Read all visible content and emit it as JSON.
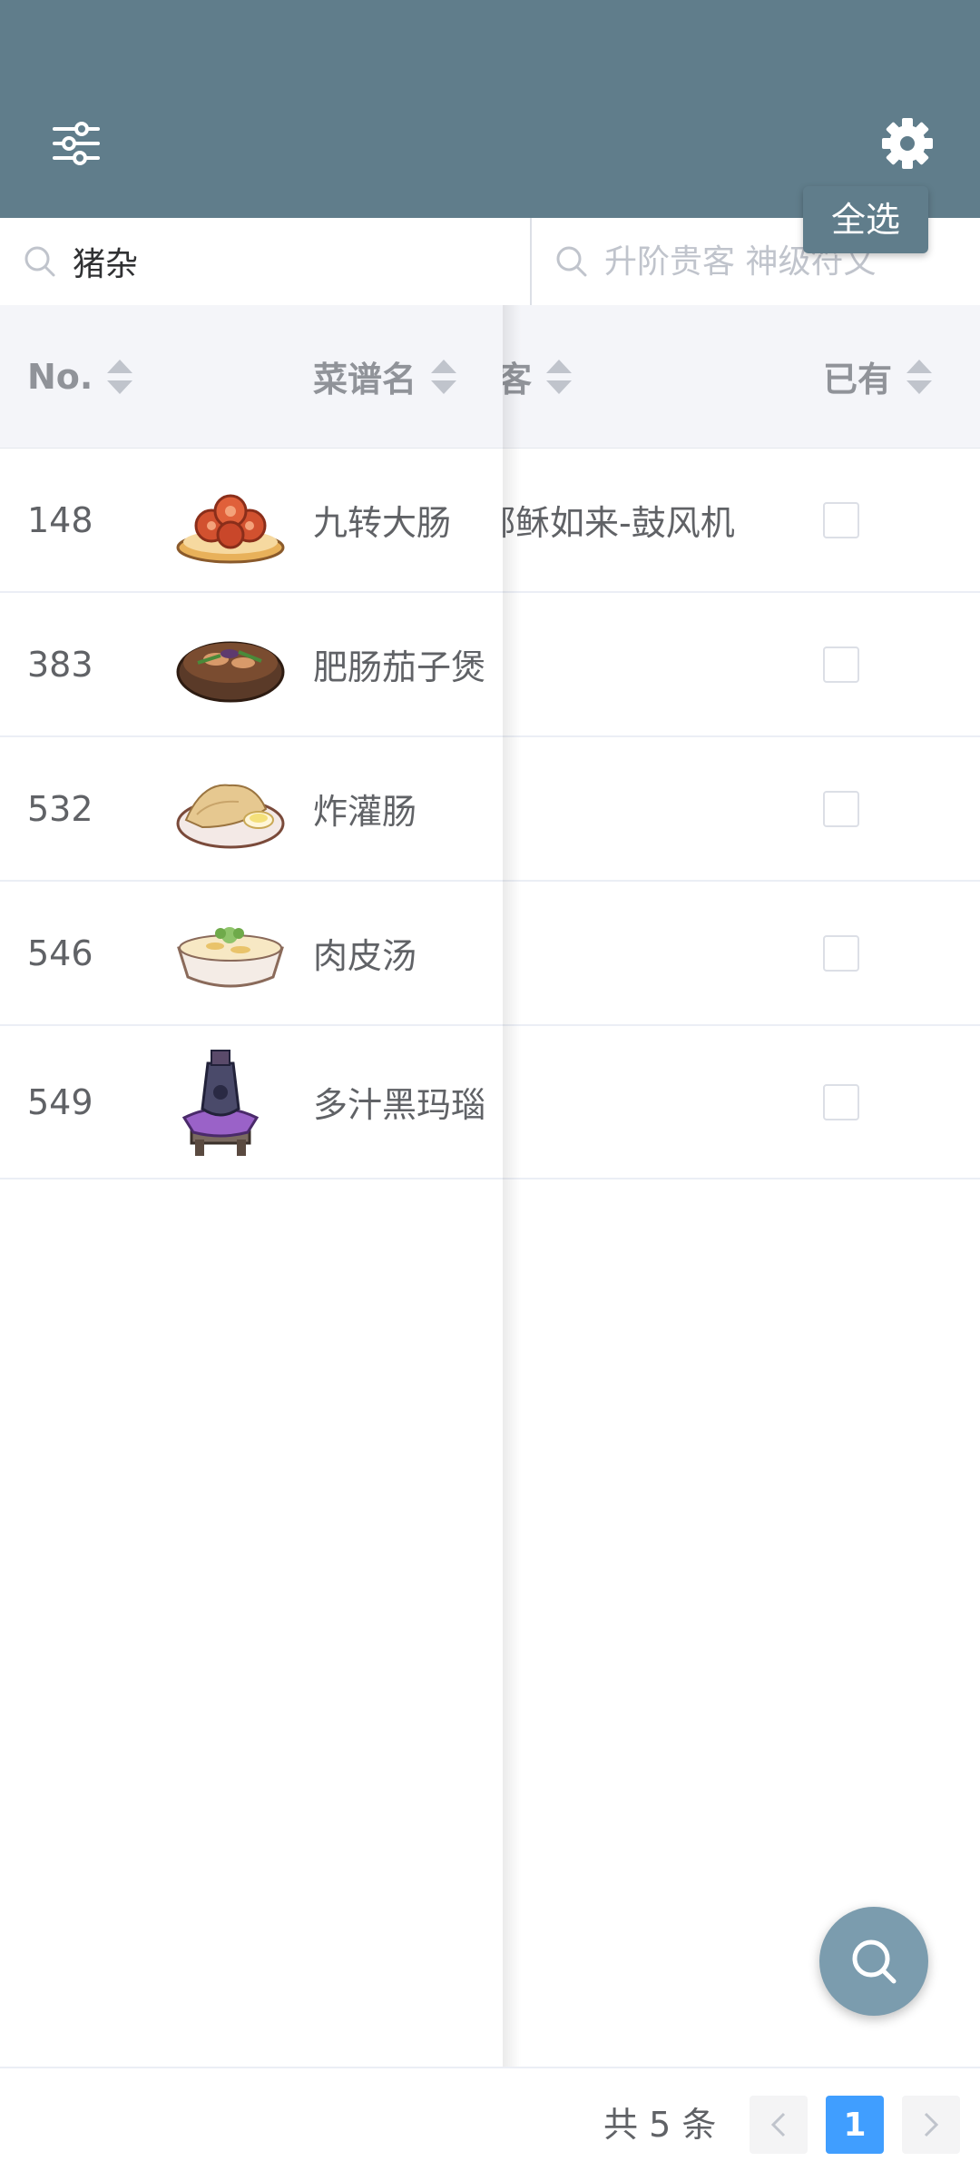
{
  "header": {
    "select_all_label": "全选",
    "filter_icon": "sliders-icon",
    "settings_icon": "gear-icon",
    "color": "#607d8b"
  },
  "search": {
    "left_value": "猪杂",
    "right_placeholder": "升阶贵客 神级符文"
  },
  "table": {
    "columns": {
      "no": "No.",
      "name": "菜谱名",
      "guest": "贵客",
      "owned": "已有"
    },
    "rows": [
      {
        "no": "148",
        "name": "九转大肠",
        "guest": "酥如来-鼓风机",
        "guest_visible": "邴稣如来-鼓风机",
        "image": "braised-intestine-dish-icon",
        "owned": false
      },
      {
        "no": "383",
        "name": "肥肠茄子煲",
        "guest": "",
        "image": "intestine-eggplant-pot-icon",
        "owned": false
      },
      {
        "no": "532",
        "name": "炸灌肠",
        "guest": "",
        "image": "fried-sausage-dish-icon",
        "owned": false
      },
      {
        "no": "546",
        "name": "肉皮汤",
        "guest": "",
        "image": "pork-skin-soup-icon",
        "owned": false
      },
      {
        "no": "549",
        "name": "多汁黑玛瑙",
        "guest": "",
        "image": "juicy-black-agate-icon",
        "owned": false
      }
    ]
  },
  "pagination": {
    "total_label": "共 5 条",
    "current_page": "1"
  },
  "fab": {
    "icon": "search-icon"
  }
}
